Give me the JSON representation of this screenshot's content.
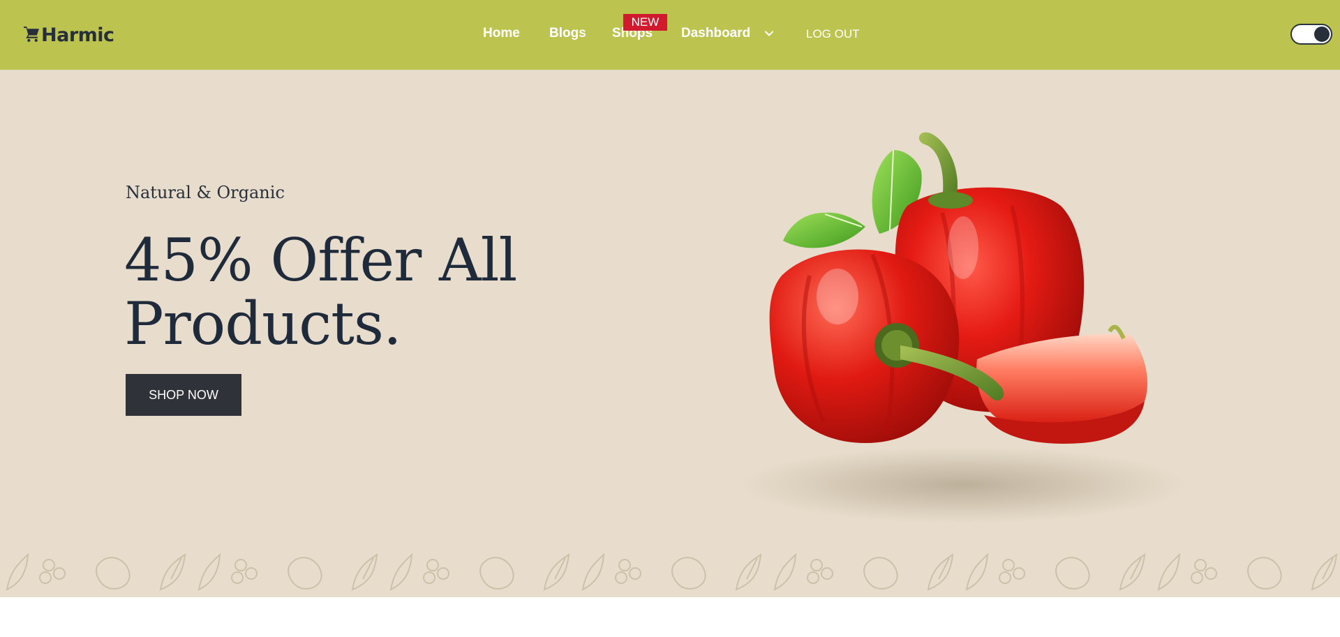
{
  "brand": {
    "name": "Harmic",
    "icon": "cart-icon"
  },
  "nav": {
    "items": [
      {
        "label": "Home"
      },
      {
        "label": "Blogs"
      },
      {
        "label": "Shops"
      },
      {
        "label": "Dashboard"
      }
    ],
    "badge": "NEW",
    "logout": "LOG OUT",
    "dropdown_icon": "chevron-down-icon"
  },
  "theme_toggle": {
    "state": "on",
    "icon": "dark-mode-toggle"
  },
  "hero": {
    "eyebrow": "Natural & Organic",
    "headline_line1": "45% Offer All",
    "headline_line2": "Products.",
    "cta": "SHOP NOW"
  },
  "colors": {
    "header_bg": "#bcc44f",
    "hero_bg": "#e8ddcc",
    "badge": "#d11a2e",
    "cta_bg": "#2f3238",
    "text_dark": "#1f2a3b"
  }
}
